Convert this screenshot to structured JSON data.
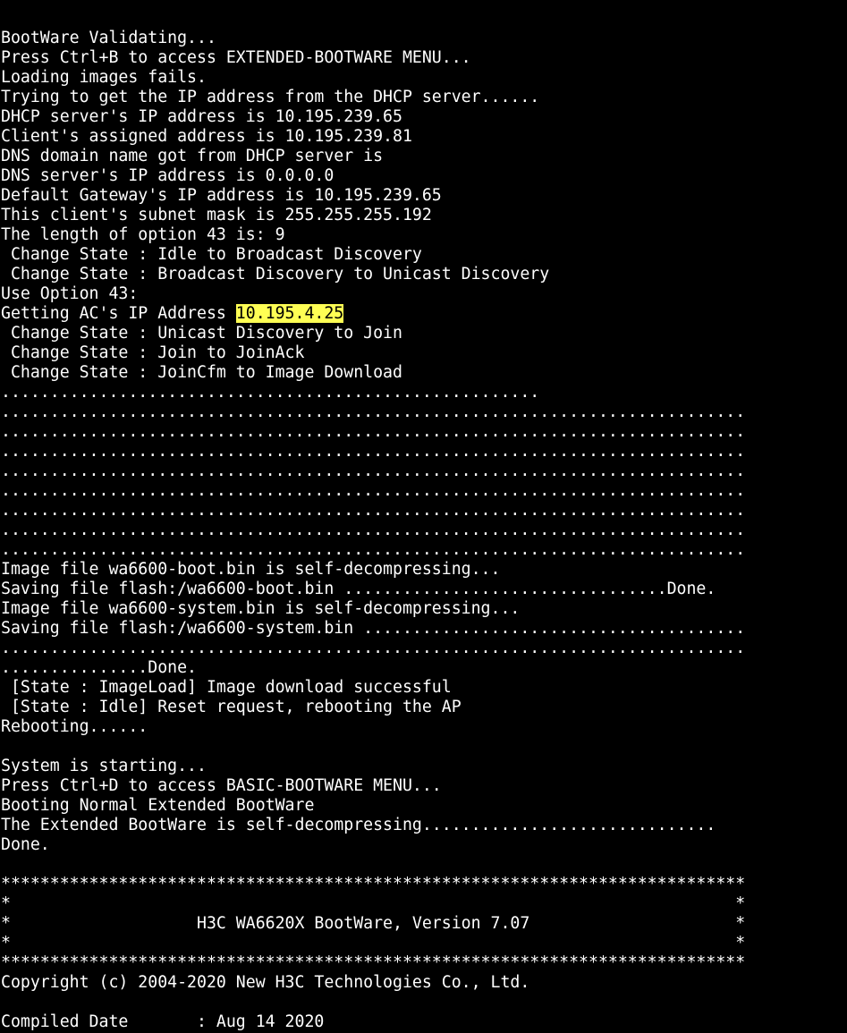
{
  "terminal": {
    "colors": {
      "background": "#000000",
      "foreground": "#ffffff",
      "highlight_bg": "#ffff54",
      "highlight_fg": "#000000"
    },
    "lines": [
      {
        "text": "BootWare Validating..."
      },
      {
        "text": "Press Ctrl+B to access EXTENDED-BOOTWARE MENU..."
      },
      {
        "text": "Loading images fails."
      },
      {
        "text": "Trying to get the IP address from the DHCP server......"
      },
      {
        "text": "DHCP server's IP address is 10.195.239.65"
      },
      {
        "text": "Client's assigned address is 10.195.239.81"
      },
      {
        "text": "DNS domain name got from DHCP server is"
      },
      {
        "text": "DNS server's IP address is 0.0.0.0"
      },
      {
        "text": "Default Gateway's IP address is 10.195.239.65"
      },
      {
        "text": "This client's subnet mask is 255.255.255.192"
      },
      {
        "text": "The length of option 43 is: 9"
      },
      {
        "text": " Change State : Idle to Broadcast Discovery"
      },
      {
        "text": " Change State : Broadcast Discovery to Unicast Discovery"
      },
      {
        "text": "Use Option 43:"
      },
      {
        "text": "Getting AC's IP Address ",
        "highlight": "10.195.4.25"
      },
      {
        "text": " Change State : Unicast Discovery to Join"
      },
      {
        "text": " Change State : Join to JoinAck"
      },
      {
        "text": " Change State : JoinCfm to Image Download"
      },
      {
        "text": "......................................................."
      },
      {
        "text": "............................................................................"
      },
      {
        "text": "............................................................................"
      },
      {
        "text": "............................................................................"
      },
      {
        "text": "............................................................................"
      },
      {
        "text": "............................................................................"
      },
      {
        "text": "............................................................................"
      },
      {
        "text": "............................................................................"
      },
      {
        "text": "............................................................................"
      },
      {
        "text": "Image file wa6600-boot.bin is self-decompressing..."
      },
      {
        "text": "Saving file flash:/wa6600-boot.bin .................................Done."
      },
      {
        "text": "Image file wa6600-system.bin is self-decompressing..."
      },
      {
        "text": "Saving file flash:/wa6600-system.bin ......................................."
      },
      {
        "text": "............................................................................"
      },
      {
        "text": "...............Done."
      },
      {
        "text": " [State : ImageLoad] Image download successful"
      },
      {
        "text": " [State : Idle] Reset request, rebooting the AP"
      },
      {
        "text": "Rebooting......"
      },
      {
        "text": ""
      },
      {
        "text": "System is starting..."
      },
      {
        "text": "Press Ctrl+D to access BASIC-BOOTWARE MENU..."
      },
      {
        "text": "Booting Normal Extended BootWare"
      },
      {
        "text": "The Extended BootWare is self-decompressing.............................."
      },
      {
        "text": "Done."
      },
      {
        "text": ""
      },
      {
        "text": "****************************************************************************"
      },
      {
        "text": "*                                                                          *"
      },
      {
        "text": "*                   H3C WA6620X BootWare, Version 7.07                     *"
      },
      {
        "text": "*                                                                          *"
      },
      {
        "text": "****************************************************************************"
      },
      {
        "text": "Copyright (c) 2004-2020 New H3C Technologies Co., Ltd."
      },
      {
        "text": ""
      },
      {
        "text": "Compiled Date       : Aug 14 2020"
      }
    ]
  }
}
